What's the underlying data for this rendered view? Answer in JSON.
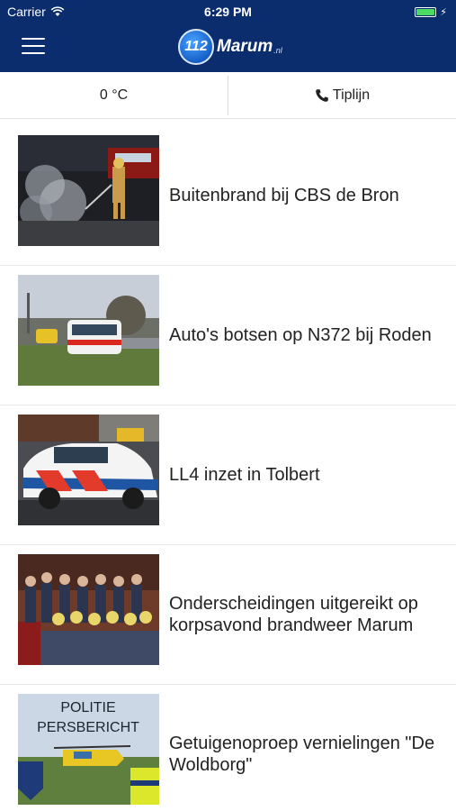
{
  "status_bar": {
    "carrier": "Carrier",
    "time": "6:29 PM"
  },
  "header": {
    "logo_number": "112",
    "logo_name": "Marum",
    "logo_suffix": ".nl",
    "brand_color": "#0b2d6e"
  },
  "info_bar": {
    "temperature": "0 °C",
    "tipline_label": "Tiplijn"
  },
  "articles": [
    {
      "title": "Buitenbrand bij CBS de Bron"
    },
    {
      "title": "Auto's botsen op N372 bij Roden"
    },
    {
      "title": "LL4 inzet in Tolbert"
    },
    {
      "title": "Onderscheidingen uitgereikt op korpsavond brandweer Marum"
    },
    {
      "title": "Getuigenoproep vernielingen \"De Woldborg\""
    }
  ],
  "thumb5_text": {
    "line1": "POLITIE",
    "line2": "PERSBERICHT"
  }
}
